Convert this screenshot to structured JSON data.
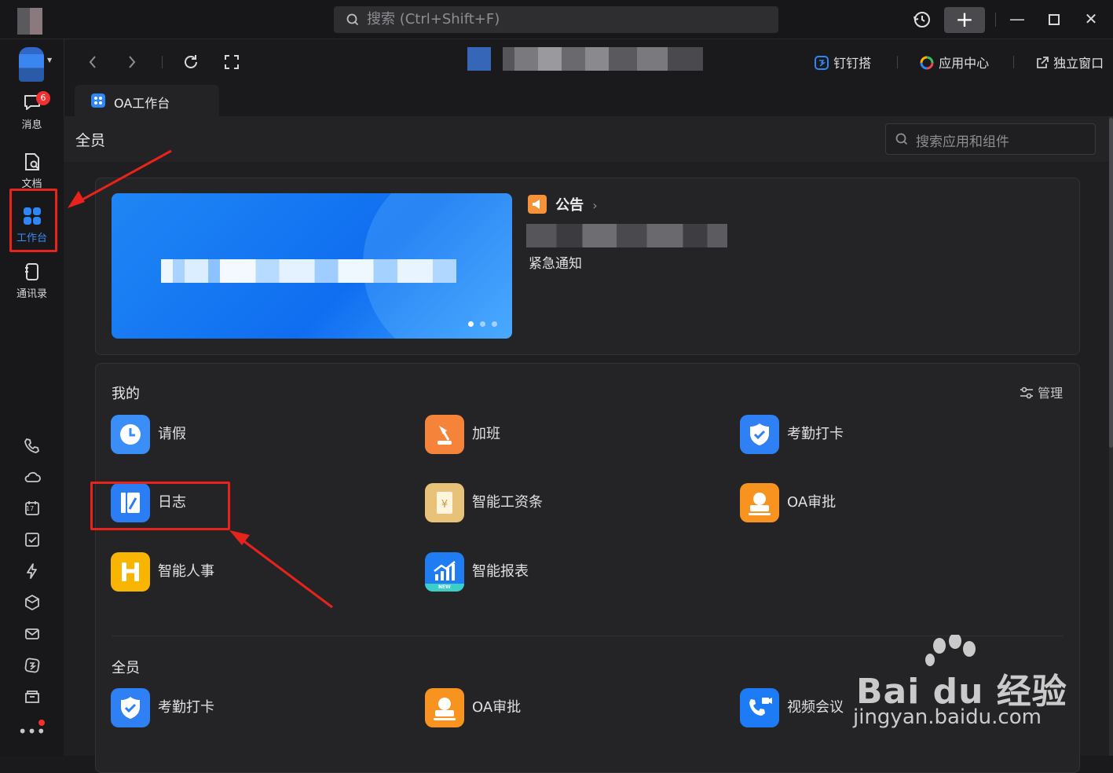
{
  "topbar": {
    "search_placeholder": "搜索 (Ctrl+Shift+F)"
  },
  "sidebar": {
    "items": [
      {
        "label": "消息",
        "badge": "6"
      },
      {
        "label": "文档"
      },
      {
        "label": "工作台"
      },
      {
        "label": "通讯录"
      }
    ],
    "tools": [
      "phone-icon",
      "cloud-icon",
      "calendar-icon",
      "todo-icon",
      "lightning-icon",
      "cube-icon",
      "mail-icon",
      "dingtalk-icon",
      "folder-icon",
      "more-icon"
    ],
    "calendar_day": "17"
  },
  "navbar": {
    "dingda": "钉钉搭",
    "app_center": "应用中心",
    "standalone": "独立窗口"
  },
  "tab": {
    "label": "OA工作台"
  },
  "header": {
    "scope": "全员",
    "search_placeholder": "搜索应用和组件"
  },
  "announcement": {
    "title": "公告",
    "item": "紧急通知"
  },
  "mine": {
    "title": "我的",
    "manage": "管理",
    "apps": [
      {
        "label": "请假",
        "color": "#3a8ef6"
      },
      {
        "label": "加班",
        "color": "#f5843a"
      },
      {
        "label": "考勤打卡",
        "color": "#2f7ff5"
      },
      {
        "label": "日志",
        "color": "#2b7df6"
      },
      {
        "label": "智能工资条",
        "color": "#e9c27a"
      },
      {
        "label": "OA审批",
        "color": "#f7931e"
      },
      {
        "label": "智能人事",
        "color": "#f7b500"
      },
      {
        "label": "智能报表",
        "color": "#1f7cf3",
        "tag": "NEW"
      }
    ]
  },
  "all": {
    "title": "全员",
    "apps": [
      {
        "label": "考勤打卡",
        "color": "#2f7ff5"
      },
      {
        "label": "OA审批",
        "color": "#f7931e"
      },
      {
        "label": "视频会议",
        "color": "#1d7cf5"
      }
    ]
  },
  "watermark": {
    "logo": "Bai du 经验",
    "url": "jingyan.baidu.com"
  }
}
